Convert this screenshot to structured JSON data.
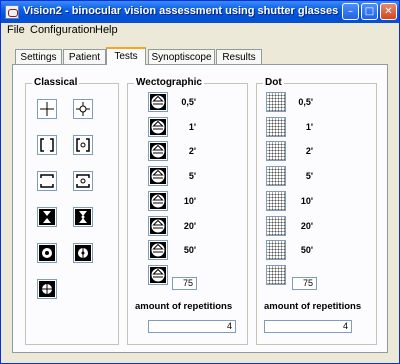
{
  "window": {
    "title": "Vision2 - binocular vision assessment using shutter glasses"
  },
  "menu": [
    "File",
    "Configuration",
    "Help"
  ],
  "tabs": [
    "Settings",
    "Patient",
    "Tests",
    "Synoptiscope",
    "Results"
  ],
  "active_tab": "Tests",
  "groups": {
    "classical": {
      "title": "Classical"
    },
    "wectographic": {
      "title": "Wectographic",
      "rows": [
        "0,5'",
        "1'",
        "2'",
        "5'",
        "10'",
        "20'",
        "50'"
      ],
      "custom_value": "75",
      "repetitions_label": "amount of repetitions",
      "repetitions_value": "4"
    },
    "dot": {
      "title": "Dot",
      "rows": [
        "0,5'",
        "1'",
        "2'",
        "5'",
        "10'",
        "20'",
        "50'"
      ],
      "custom_value": "75",
      "repetitions_label": "amount of repetitions",
      "repetitions_value": "4"
    }
  },
  "colors": {
    "titlebar": "#0a5ee8",
    "active_tab_accent": "#f5a623"
  }
}
